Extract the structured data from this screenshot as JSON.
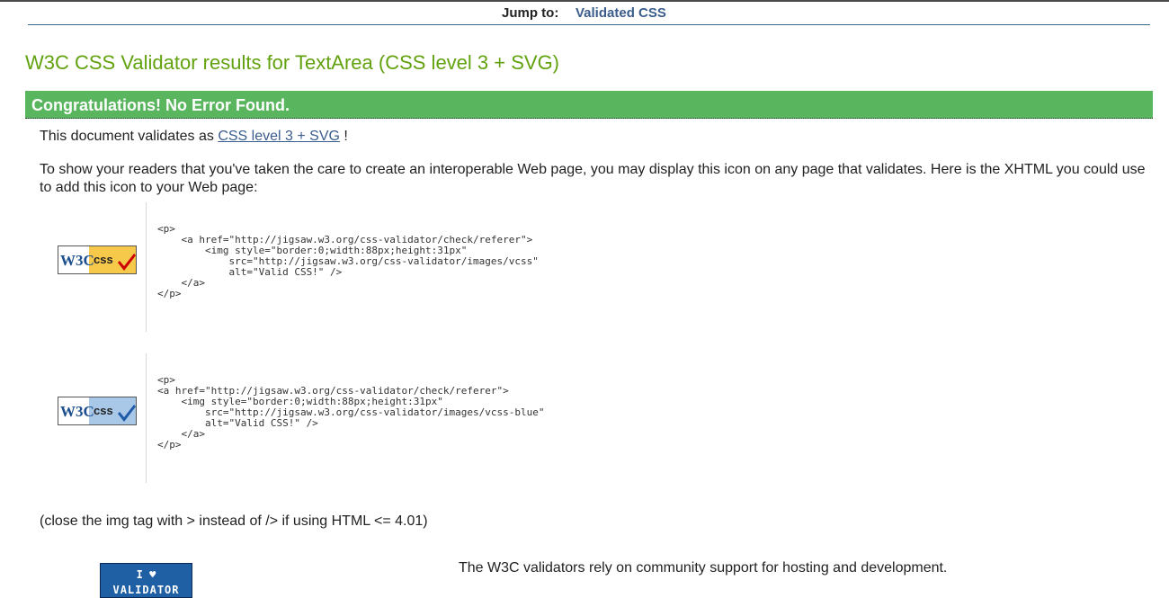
{
  "nav": {
    "jump_label": "Jump to:",
    "jump_link": "Validated CSS"
  },
  "page_title": "W3C CSS Validator results for TextArea (CSS level 3 + SVG)",
  "result_banner": "Congratulations! No Error Found.",
  "validates": {
    "prefix": "This document validates as",
    "link": "CSS level 3 + SVG",
    "suffix": "!"
  },
  "icon_paragraph": "To show your readers that you've taken the care to create an interoperable Web page, you may display this icon on any page that validates. Here is the XHTML you could use to add this icon to your Web page:",
  "badges": [
    {
      "name": "vcss",
      "w3c_text": "W3C",
      "css_text": "css",
      "check_color": "#cc0000",
      "bg_color": "#f7c94b",
      "code": "<p>\n    <a href=\"http://jigsaw.w3.org/css-validator/check/referer\">\n        <img style=\"border:0;width:88px;height:31px\"\n            src=\"http://jigsaw.w3.org/css-validator/images/vcss\"\n            alt=\"Valid CSS!\" />\n    </a>\n</p>"
    },
    {
      "name": "vcss-blue",
      "w3c_text": "W3C",
      "css_text": "css",
      "check_color": "#1e5aa8",
      "bg_color": "#a9c8e8",
      "code": "<p>\n<a href=\"http://jigsaw.w3.org/css-validator/check/referer\">\n    <img style=\"border:0;width:88px;height:31px\"\n        src=\"http://jigsaw.w3.org/css-validator/images/vcss-blue\"\n        alt=\"Valid CSS!\" />\n    </a>\n</p>"
    }
  ],
  "close_note": "(close the img tag with > instead of /> if using HTML <= 4.01)",
  "donate": {
    "line1": "I ♥",
    "line2": "VALIDATOR"
  },
  "community_text": "The W3C validators rely on community support for hosting and development."
}
